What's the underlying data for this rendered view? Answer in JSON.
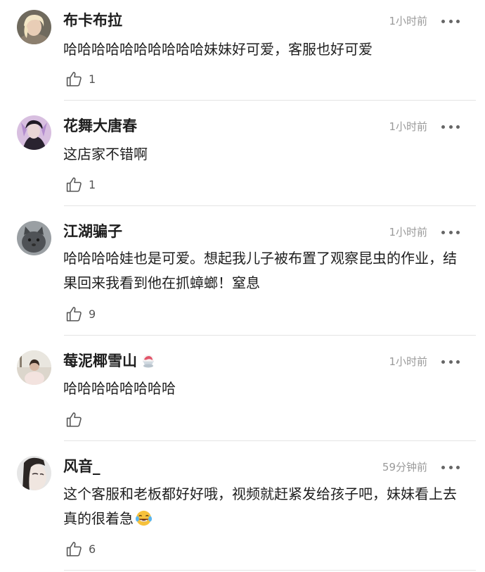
{
  "comments": [
    {
      "username": "布卡布拉",
      "time": "1小时前",
      "text": "哈哈哈哈哈哈哈哈哈哈妹妹好可爱，客服也好可爱",
      "likes": "1"
    },
    {
      "username": "花舞大唐春",
      "time": "1小时前",
      "text": "这店家不错啊",
      "likes": "1"
    },
    {
      "username": "江湖骗子",
      "time": "1小时前",
      "text": "哈哈哈哈娃也是可爱。想起我儿子被布置了观察昆虫的作业，结果回来我看到他在抓蟑螂！窒息",
      "likes": "9"
    },
    {
      "username": "莓泥椰雪山",
      "time": "1小时前",
      "text": "哈哈哈哈哈哈哈哈",
      "likes": ""
    },
    {
      "username": "风音_",
      "time": "59分钟前",
      "text": "这个客服和老板都好好哦，视频就赶紧发给孩子吧，妹妹看上去真的很着急",
      "likes": "6"
    }
  ],
  "icons": {
    "like": "thumbs-up-icon",
    "more": "more-icon",
    "username_emoji": "shaved-ice-emoji",
    "content_emoji": "laughing-tears-emoji"
  },
  "colors": {
    "username": "#1e1e1e",
    "text": "#1e1e1e",
    "time": "#9a9a9a",
    "divider": "#e4e4e4"
  }
}
